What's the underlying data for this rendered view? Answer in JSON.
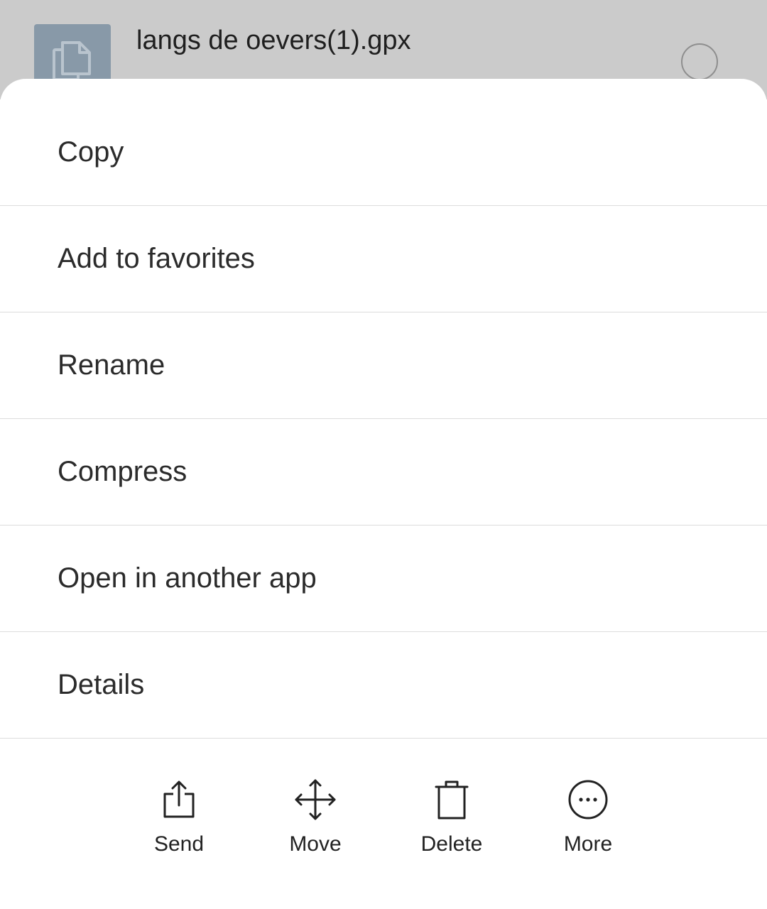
{
  "background_row": {
    "file_name": "langs de oevers(1).gpx",
    "thumb_icon": "document-copy-icon",
    "thumb_color": "#8899a8"
  },
  "sheet": {
    "menu_items": [
      {
        "label": "Copy"
      },
      {
        "label": "Add to favorites"
      },
      {
        "label": "Rename"
      },
      {
        "label": "Compress"
      },
      {
        "label": "Open in another app"
      },
      {
        "label": "Details"
      }
    ],
    "actions": [
      {
        "label": "Send",
        "icon": "share-icon"
      },
      {
        "label": "Move",
        "icon": "move-arrows-icon"
      },
      {
        "label": "Delete",
        "icon": "trash-icon"
      },
      {
        "label": "More",
        "icon": "more-circle-icon"
      }
    ]
  },
  "colors": {
    "scrim": "#cbcbcb",
    "sheet_background": "#ffffff",
    "divider": "#dcdcdc",
    "text_primary": "#2b2b2b"
  }
}
